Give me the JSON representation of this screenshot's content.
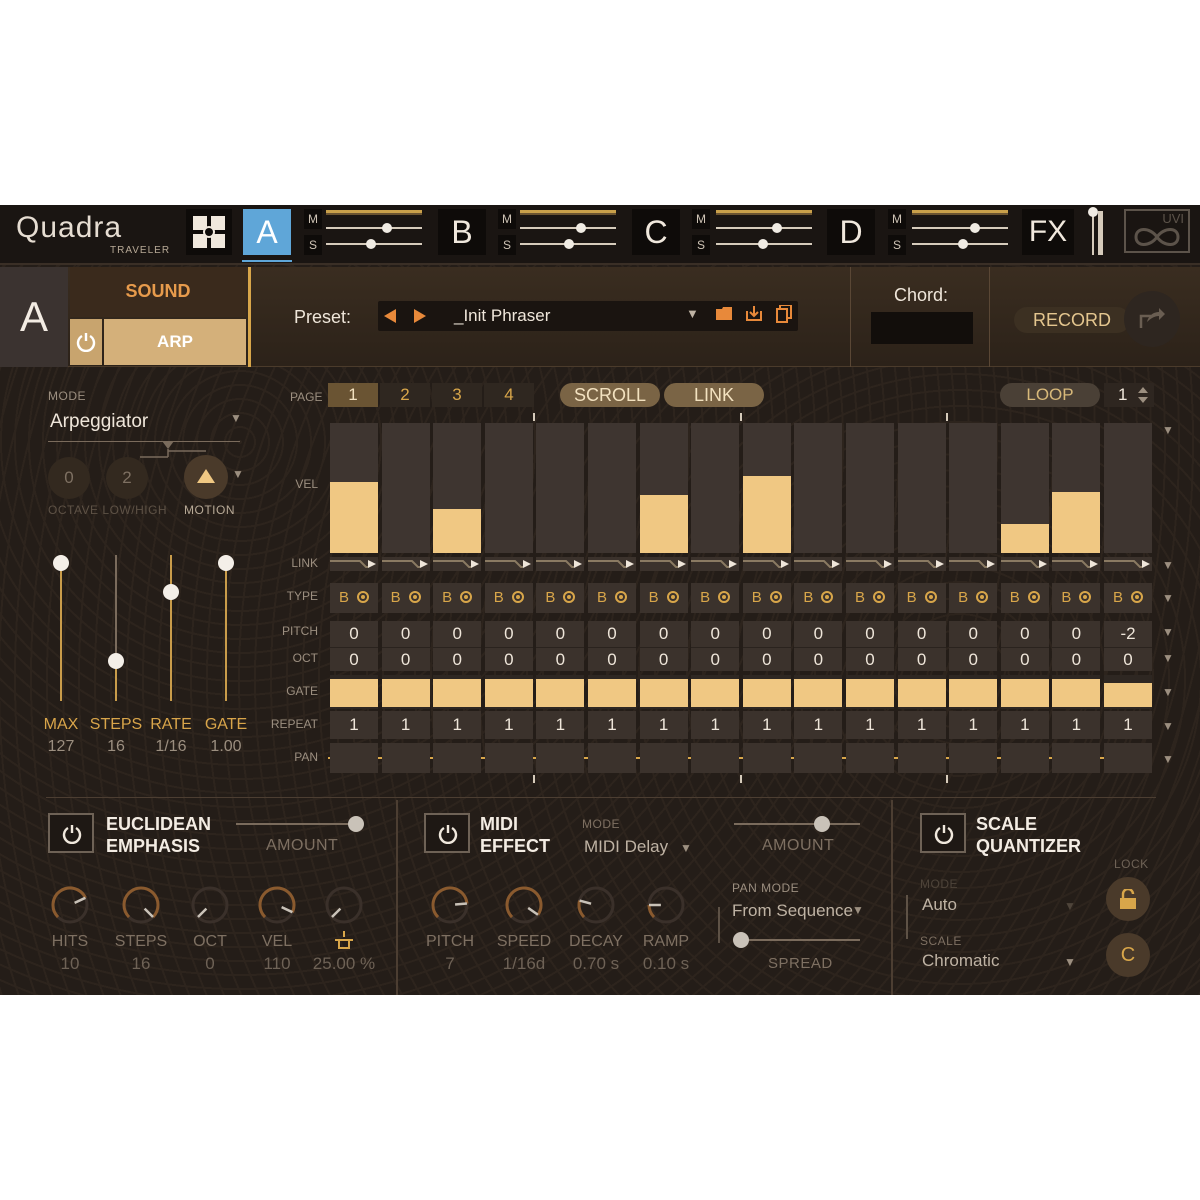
{
  "app": {
    "logo": "Quadra",
    "logo_sub": "TRAVELER",
    "parts": [
      "A",
      "B",
      "C",
      "D"
    ],
    "active_part": "A",
    "mute_label": "M",
    "solo_label": "S",
    "fx_label": "FX",
    "brand": "UVI"
  },
  "header": {
    "part_letter": "A",
    "sound_tab": "SOUND",
    "arp_tab": "ARP",
    "preset_label": "Preset:",
    "preset_name": "_Init Phraser",
    "chord_label": "Chord:",
    "chord_value": "",
    "record_label": "RECORD"
  },
  "left": {
    "mode_label": "MODE",
    "mode_value": "Arpeggiator",
    "octave_low": "0",
    "octave_high": "2",
    "octave_label": "OCTAVE LOW/HIGH",
    "motion_label": "MOTION",
    "sliders": [
      {
        "label": "MAX",
        "value": "127",
        "level": 1.0
      },
      {
        "label": "STEPS",
        "value": "16",
        "level": 0.0
      },
      {
        "label": "RATE",
        "value": "1/16",
        "level": 0.78
      },
      {
        "label": "GATE",
        "value": "1.00",
        "level": 1.0
      }
    ]
  },
  "sequencer": {
    "page_label": "PAGE",
    "pages": [
      "1",
      "2",
      "3",
      "4"
    ],
    "active_page": "1",
    "scroll_label": "SCROLL",
    "link_label": "LINK",
    "loop_label": "LOOP",
    "loop_value": "1",
    "row_labels": {
      "vel": "VEL",
      "link": "LINK",
      "type": "TYPE",
      "pitch": "PITCH",
      "oct": "OCT",
      "gate": "GATE",
      "repeat": "REPEAT",
      "pan": "PAN"
    },
    "type_text": "B",
    "velocity": [
      0.55,
      0,
      0.34,
      0,
      0,
      0,
      0.45,
      0,
      0.59,
      0,
      0,
      0,
      0,
      0.22,
      0.47,
      0
    ],
    "pitch": [
      "0",
      "0",
      "0",
      "0",
      "0",
      "0",
      "0",
      "0",
      "0",
      "0",
      "0",
      "0",
      "0",
      "0",
      "0",
      "-2"
    ],
    "oct": [
      "0",
      "0",
      "0",
      "0",
      "0",
      "0",
      "0",
      "0",
      "0",
      "0",
      "0",
      "0",
      "0",
      "0",
      "0",
      "0"
    ],
    "gate": [
      1,
      1,
      1,
      1,
      1,
      1,
      1,
      1,
      1,
      1,
      1,
      1,
      1,
      1,
      1,
      0.8
    ],
    "repeat": [
      "1",
      "1",
      "1",
      "1",
      "1",
      "1",
      "1",
      "1",
      "1",
      "1",
      "1",
      "1",
      "1",
      "1",
      "1",
      "1"
    ]
  },
  "euclidean": {
    "title_1": "EUCLIDEAN",
    "title_2": "EMPHASIS",
    "amount_label": "AMOUNT",
    "knobs": [
      {
        "label": "HITS",
        "value": "10"
      },
      {
        "label": "STEPS",
        "value": "16"
      },
      {
        "label": "OCT",
        "value": "0"
      },
      {
        "label": "VEL",
        "value": "110"
      },
      {
        "label": "",
        "value": "25.00 %"
      }
    ]
  },
  "midi_effect": {
    "title_1": "MIDI",
    "title_2": "EFFECT",
    "mode_label": "MODE",
    "mode_value": "MIDI Delay",
    "amount_label": "AMOUNT",
    "pan_mode_label": "PAN MODE",
    "pan_mode_value": "From Sequence",
    "spread_label": "SPREAD",
    "knobs": [
      {
        "label": "PITCH",
        "value": "7"
      },
      {
        "label": "SPEED",
        "value": "1/16d"
      },
      {
        "label": "DECAY",
        "value": "0.70 s"
      },
      {
        "label": "RAMP",
        "value": "0.10 s"
      }
    ]
  },
  "scale_quantizer": {
    "title_1": "SCALE",
    "title_2": "QUANTIZER",
    "mode_label": "MODE",
    "mode_value": "Auto",
    "scale_label": "SCALE",
    "scale_value": "Chromatic",
    "lock_label": "LOCK",
    "key_value": "C"
  }
}
